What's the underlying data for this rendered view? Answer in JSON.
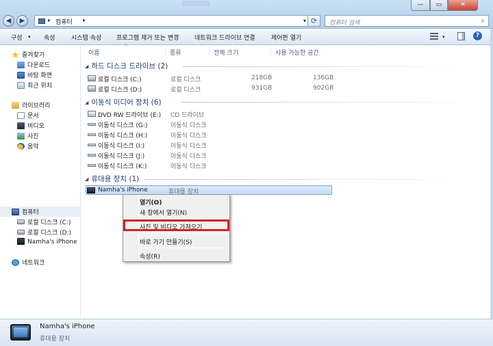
{
  "window": {
    "min_glyph": "—",
    "max_glyph": "▭",
    "close_glyph": "✕"
  },
  "address": {
    "back_glyph": "◀",
    "forward_glyph": "▶",
    "separator": "▸",
    "crumb": "컴퓨터",
    "dropdown_glyph": "▾",
    "refresh_glyph": "⟳"
  },
  "search": {
    "placeholder": "컴퓨터 검색",
    "icon": "search-icon",
    "glyph": "⌕"
  },
  "toolbar": {
    "organize": "구성",
    "organize_caret": "▾",
    "properties": "속성",
    "system_properties": "시스템 속성",
    "uninstall": "프로그램 제거 또는 변경",
    "map_drive": "네트워크 드라이브 연결",
    "control_panel": "제어판 열기",
    "view_caret": "▾",
    "help_glyph": "?"
  },
  "nav": {
    "favorites": "즐겨찾기",
    "downloads": "다운로드",
    "desktop": "바탕 화면",
    "recent": "최근 위치",
    "libraries": "라이브러리",
    "documents": "문서",
    "videos": "비디오",
    "pictures": "사진",
    "music": "음악",
    "computer": "컴퓨터",
    "drive_c": "로컬 디스크 (C:)",
    "drive_d": "로컬 디스크 (D:)",
    "iphone": "Namha's iPhone",
    "network": "네트워크"
  },
  "columns": {
    "name": "이름",
    "sort_caret": "^",
    "type": "종류",
    "total": "전체 크기",
    "free": "사용 가능한 공간"
  },
  "groups": {
    "hdd": "하드 디스크 드라이브 (2)",
    "removable": "이동식 미디어 장치 (6)",
    "portable": "휴대용 장치 (1)",
    "caret": "◢"
  },
  "hdd_rows": [
    {
      "name": "로컬 디스크 (C:)",
      "type": "로컬 디스크",
      "total": "218GB",
      "free": "136GB"
    },
    {
      "name": "로컬 디스크 (D:)",
      "type": "로컬 디스크",
      "total": "931GB",
      "free": "902GB"
    }
  ],
  "removable_rows": [
    {
      "name": "DVD RW 드라이브 (E:)",
      "type": "CD 드라이브"
    },
    {
      "name": "이동식 디스크 (G:)",
      "type": "이동식 디스크"
    },
    {
      "name": "이동식 디스크 (H:)",
      "type": "이동식 디스크"
    },
    {
      "name": "이동식 디스크 (I:)",
      "type": "이동식 디스크"
    },
    {
      "name": "이동식 디스크 (J:)",
      "type": "이동식 디스크"
    },
    {
      "name": "이동식 디스크 (K:)",
      "type": "이동식 디스크"
    }
  ],
  "portable_rows": [
    {
      "name": "Namha's iPhone",
      "type": "휴대용 장치"
    }
  ],
  "context_menu": {
    "open": "열기(O)",
    "open_new_window": "새 창에서 열기(N)",
    "import": "사진 및 비디오 가져오기",
    "create_shortcut": "바로 가기 만들기(S)",
    "properties": "속성(R)",
    "highlight_color": "#d3222a"
  },
  "details": {
    "name": "Namha's iPhone",
    "type": "휴대용 장치"
  }
}
